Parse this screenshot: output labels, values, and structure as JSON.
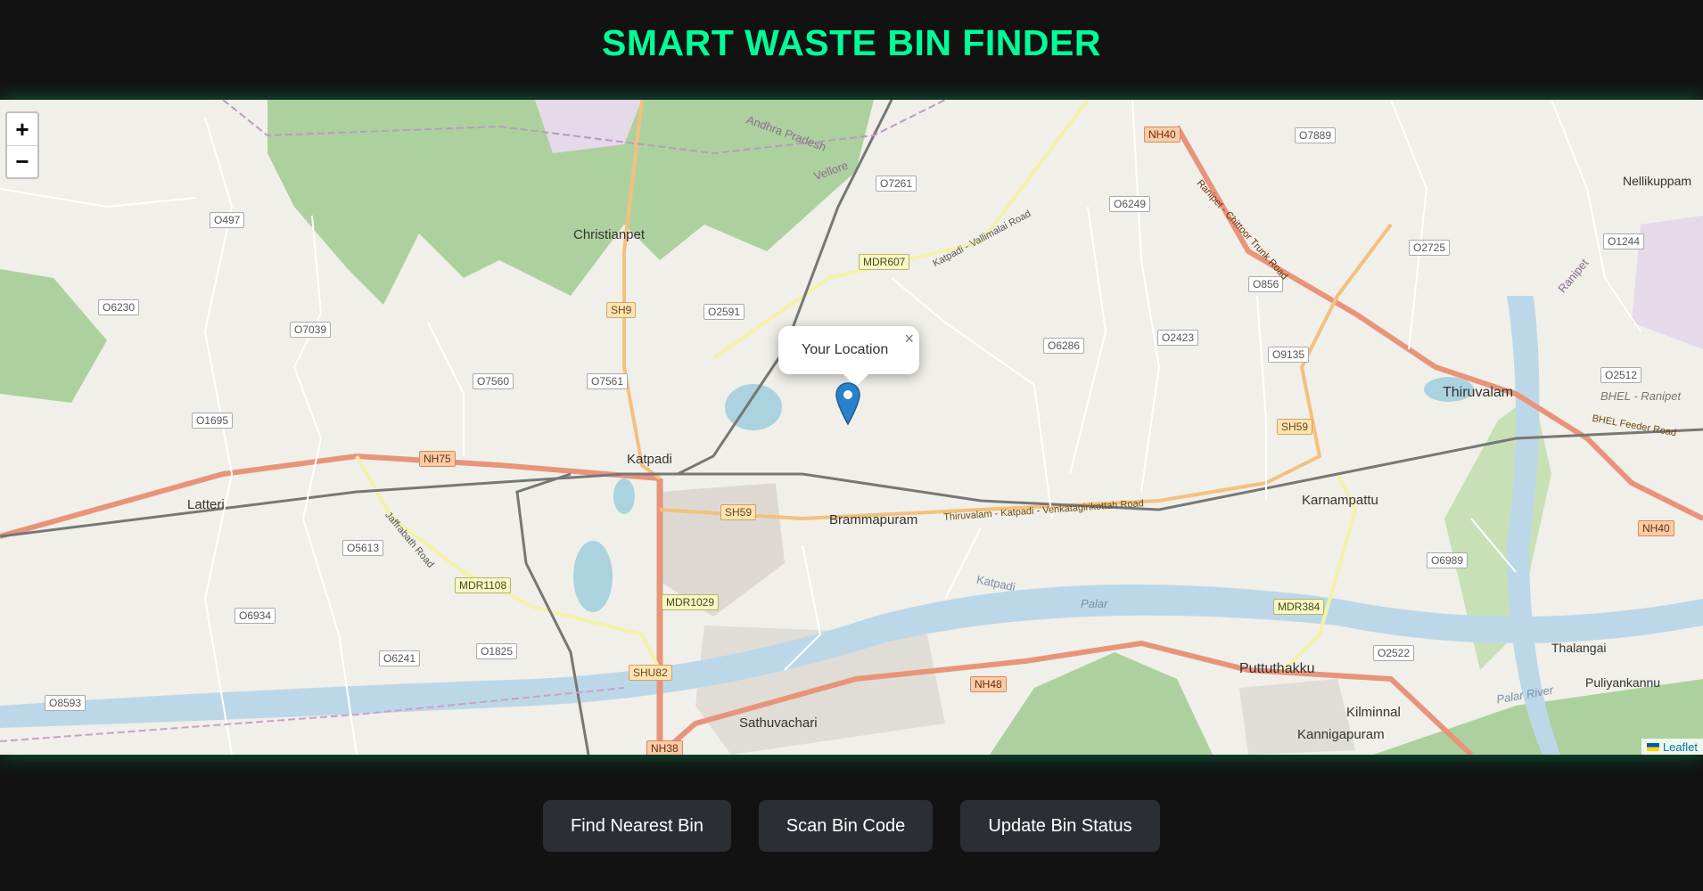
{
  "header": {
    "title": "SMART WASTE BIN FINDER"
  },
  "map": {
    "zoom_in": "+",
    "zoom_out": "−",
    "popup": {
      "text": "Your Location",
      "close": "×"
    },
    "attribution": "Leaflet",
    "places": [
      {
        "id": "christianpet",
        "name": "Christianpet"
      },
      {
        "id": "katpadi",
        "name": "Katpadi"
      },
      {
        "id": "latteri",
        "name": "Latteri"
      },
      {
        "id": "brammapuram",
        "name": "Brammapuram"
      },
      {
        "id": "karnampattu",
        "name": "Karnampattu"
      },
      {
        "id": "thiruvalam",
        "name": "Thiruvalam"
      },
      {
        "id": "puttuthakku",
        "name": "Puttuthakku"
      },
      {
        "id": "sathuvachari",
        "name": "Sathuvachari"
      },
      {
        "id": "kilminnal",
        "name": "Kilminnal"
      },
      {
        "id": "kannigapuram",
        "name": "Kannigapuram"
      },
      {
        "id": "nellikuppam",
        "name": "Nellikuppam"
      },
      {
        "id": "thalangai",
        "name": "Thalangai"
      },
      {
        "id": "puliyankannu",
        "name": "Puliyankannu"
      }
    ],
    "road_labels": [
      "NH40",
      "NH75",
      "NH48",
      "NH38",
      "NH40",
      "SH9",
      "SH59",
      "SH59",
      "SHU82",
      "MDR607",
      "MDR1108",
      "MDR1029",
      "MDR384",
      "O497",
      "O6230",
      "O7039",
      "O1695",
      "O7560",
      "O7561",
      "O2591",
      "O7261",
      "O6249",
      "O7889",
      "O856",
      "O2725",
      "O1244",
      "O6286",
      "O2423",
      "O9135",
      "O2512",
      "O5613",
      "O6934",
      "O6241",
      "O1825",
      "O8593",
      "O6989",
      "O2522"
    ],
    "area_labels": [
      "Andhra Pradesh",
      "Vellore",
      "Katpadi",
      "Palar",
      "Palar River",
      "BHEL - Ranipet",
      "BHEL Feeder Road",
      "Ranipet",
      "Thiruvalam - Katpadi - Venkatagirikottah Road",
      "Katpadi - Vallimalai Road",
      "Ranipet - Chittoor Trunk Road",
      "Jaffrabath Road"
    ]
  },
  "actions": {
    "find": "Find Nearest Bin",
    "scan": "Scan Bin Code",
    "update": "Update Bin Status"
  },
  "colors": {
    "accent": "#00ff99",
    "button_bg": "#2b2f33",
    "marker": "#2a81cb"
  }
}
